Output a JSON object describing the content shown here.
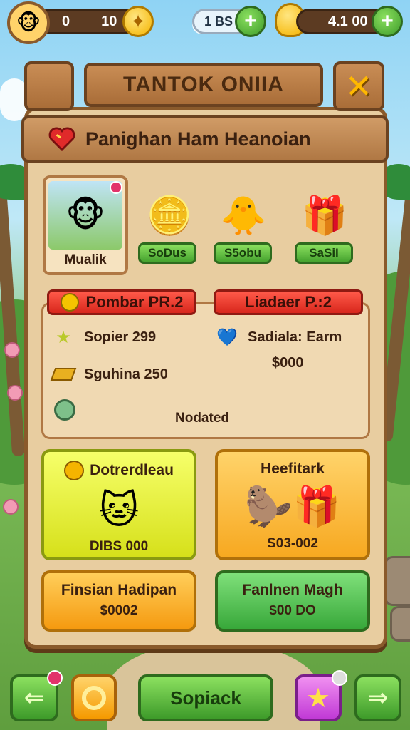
{
  "hud": {
    "coins_left": "0",
    "coins_right": "10",
    "gems": "1 BS",
    "gold": "4.1 00"
  },
  "panel": {
    "title": "TANTOK ONIIA",
    "subtitle": "Panighan Ham Heanoian"
  },
  "items": {
    "featured_label": "Mualik",
    "item1_price": "SoDus",
    "item2_price": "S5obu",
    "item3_price": "SaSiI"
  },
  "info": {
    "left_banner": "Pombar PR.2",
    "right_banner": "Liadaer P.:2",
    "line1": "Sopier 299",
    "line2": "Sguhina 250",
    "right_line1": "Sadiala: Earm",
    "right_line2": "$000",
    "note": "Nodated"
  },
  "shop": {
    "card1_title": "Dotrerdleau",
    "card1_price": "DIBS 000",
    "card2_title": "Heefitark",
    "card2_price": "S03-002",
    "card3_title": "Finsian Hadipan",
    "card3_price": "$0002",
    "card4_title": "Fanlnen Magh",
    "card4_price": "$00 DO"
  },
  "nav": {
    "center_label": "Sopiack"
  },
  "colors": {
    "wood": "#a96d38",
    "panel": "#e8cda0",
    "green": "#46a32f",
    "red": "#d8271c",
    "yellow": "#eef03a",
    "orange": "#f7a820"
  },
  "icons": [
    "avatar-icon",
    "plus-icon",
    "coin-icon",
    "bell-icon",
    "close-icon",
    "heart-icon",
    "star-icon",
    "gold-bar-icon",
    "gem-icon",
    "medal-icon",
    "back-arrow-icon",
    "next-arrow-icon"
  ]
}
